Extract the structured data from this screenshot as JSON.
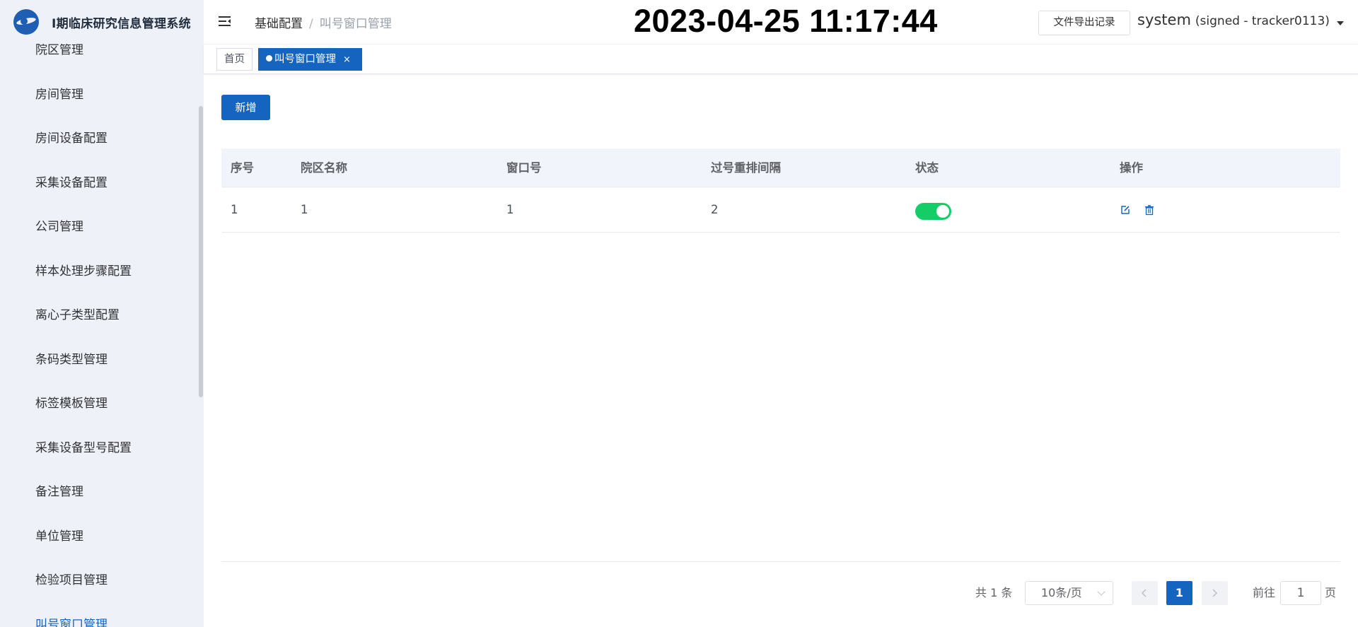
{
  "app": {
    "title": "I期临床研究信息管理系统"
  },
  "sidebar": {
    "items": [
      {
        "label": "院区管理",
        "active": false
      },
      {
        "label": "房间管理",
        "active": false
      },
      {
        "label": "房间设备配置",
        "active": false
      },
      {
        "label": "采集设备配置",
        "active": false
      },
      {
        "label": "公司管理",
        "active": false
      },
      {
        "label": "样本处理步骤配置",
        "active": false
      },
      {
        "label": "离心子类型配置",
        "active": false
      },
      {
        "label": "条码类型管理",
        "active": false
      },
      {
        "label": "标签模板管理",
        "active": false
      },
      {
        "label": "采集设备型号配置",
        "active": false
      },
      {
        "label": "备注管理",
        "active": false
      },
      {
        "label": "单位管理",
        "active": false
      },
      {
        "label": "检验项目管理",
        "active": false
      },
      {
        "label": "叫号窗口管理",
        "active": true
      }
    ]
  },
  "header": {
    "breadcrumb_root": "基础配置",
    "breadcrumb_separator": "/",
    "breadcrumb_current": "叫号窗口管理",
    "clock": "2023-04-25 11:17:44",
    "export_label": "文件导出记录",
    "user_name": "system",
    "user_sub": "(signed - tracker0113)"
  },
  "tags": {
    "home": "首页",
    "active": "叫号窗口管理",
    "close": "×"
  },
  "toolbar": {
    "add_label": "新增"
  },
  "table": {
    "columns": [
      "序号",
      "院区名称",
      "窗口号",
      "过号重排间隔",
      "状态",
      "操作"
    ],
    "rows": [
      {
        "index": "1",
        "campus": "1",
        "window": "1",
        "interval": "2",
        "status_on": true
      }
    ]
  },
  "pagination": {
    "total": "共 1 条",
    "page_size": "10条/页",
    "current_page": "1",
    "goto_label": "前往",
    "goto_value": "1",
    "goto_suffix": "页"
  },
  "colors": {
    "primary": "#1565c0",
    "switch_on": "#13ce66",
    "sidebar_bg": "#eef1f8"
  }
}
